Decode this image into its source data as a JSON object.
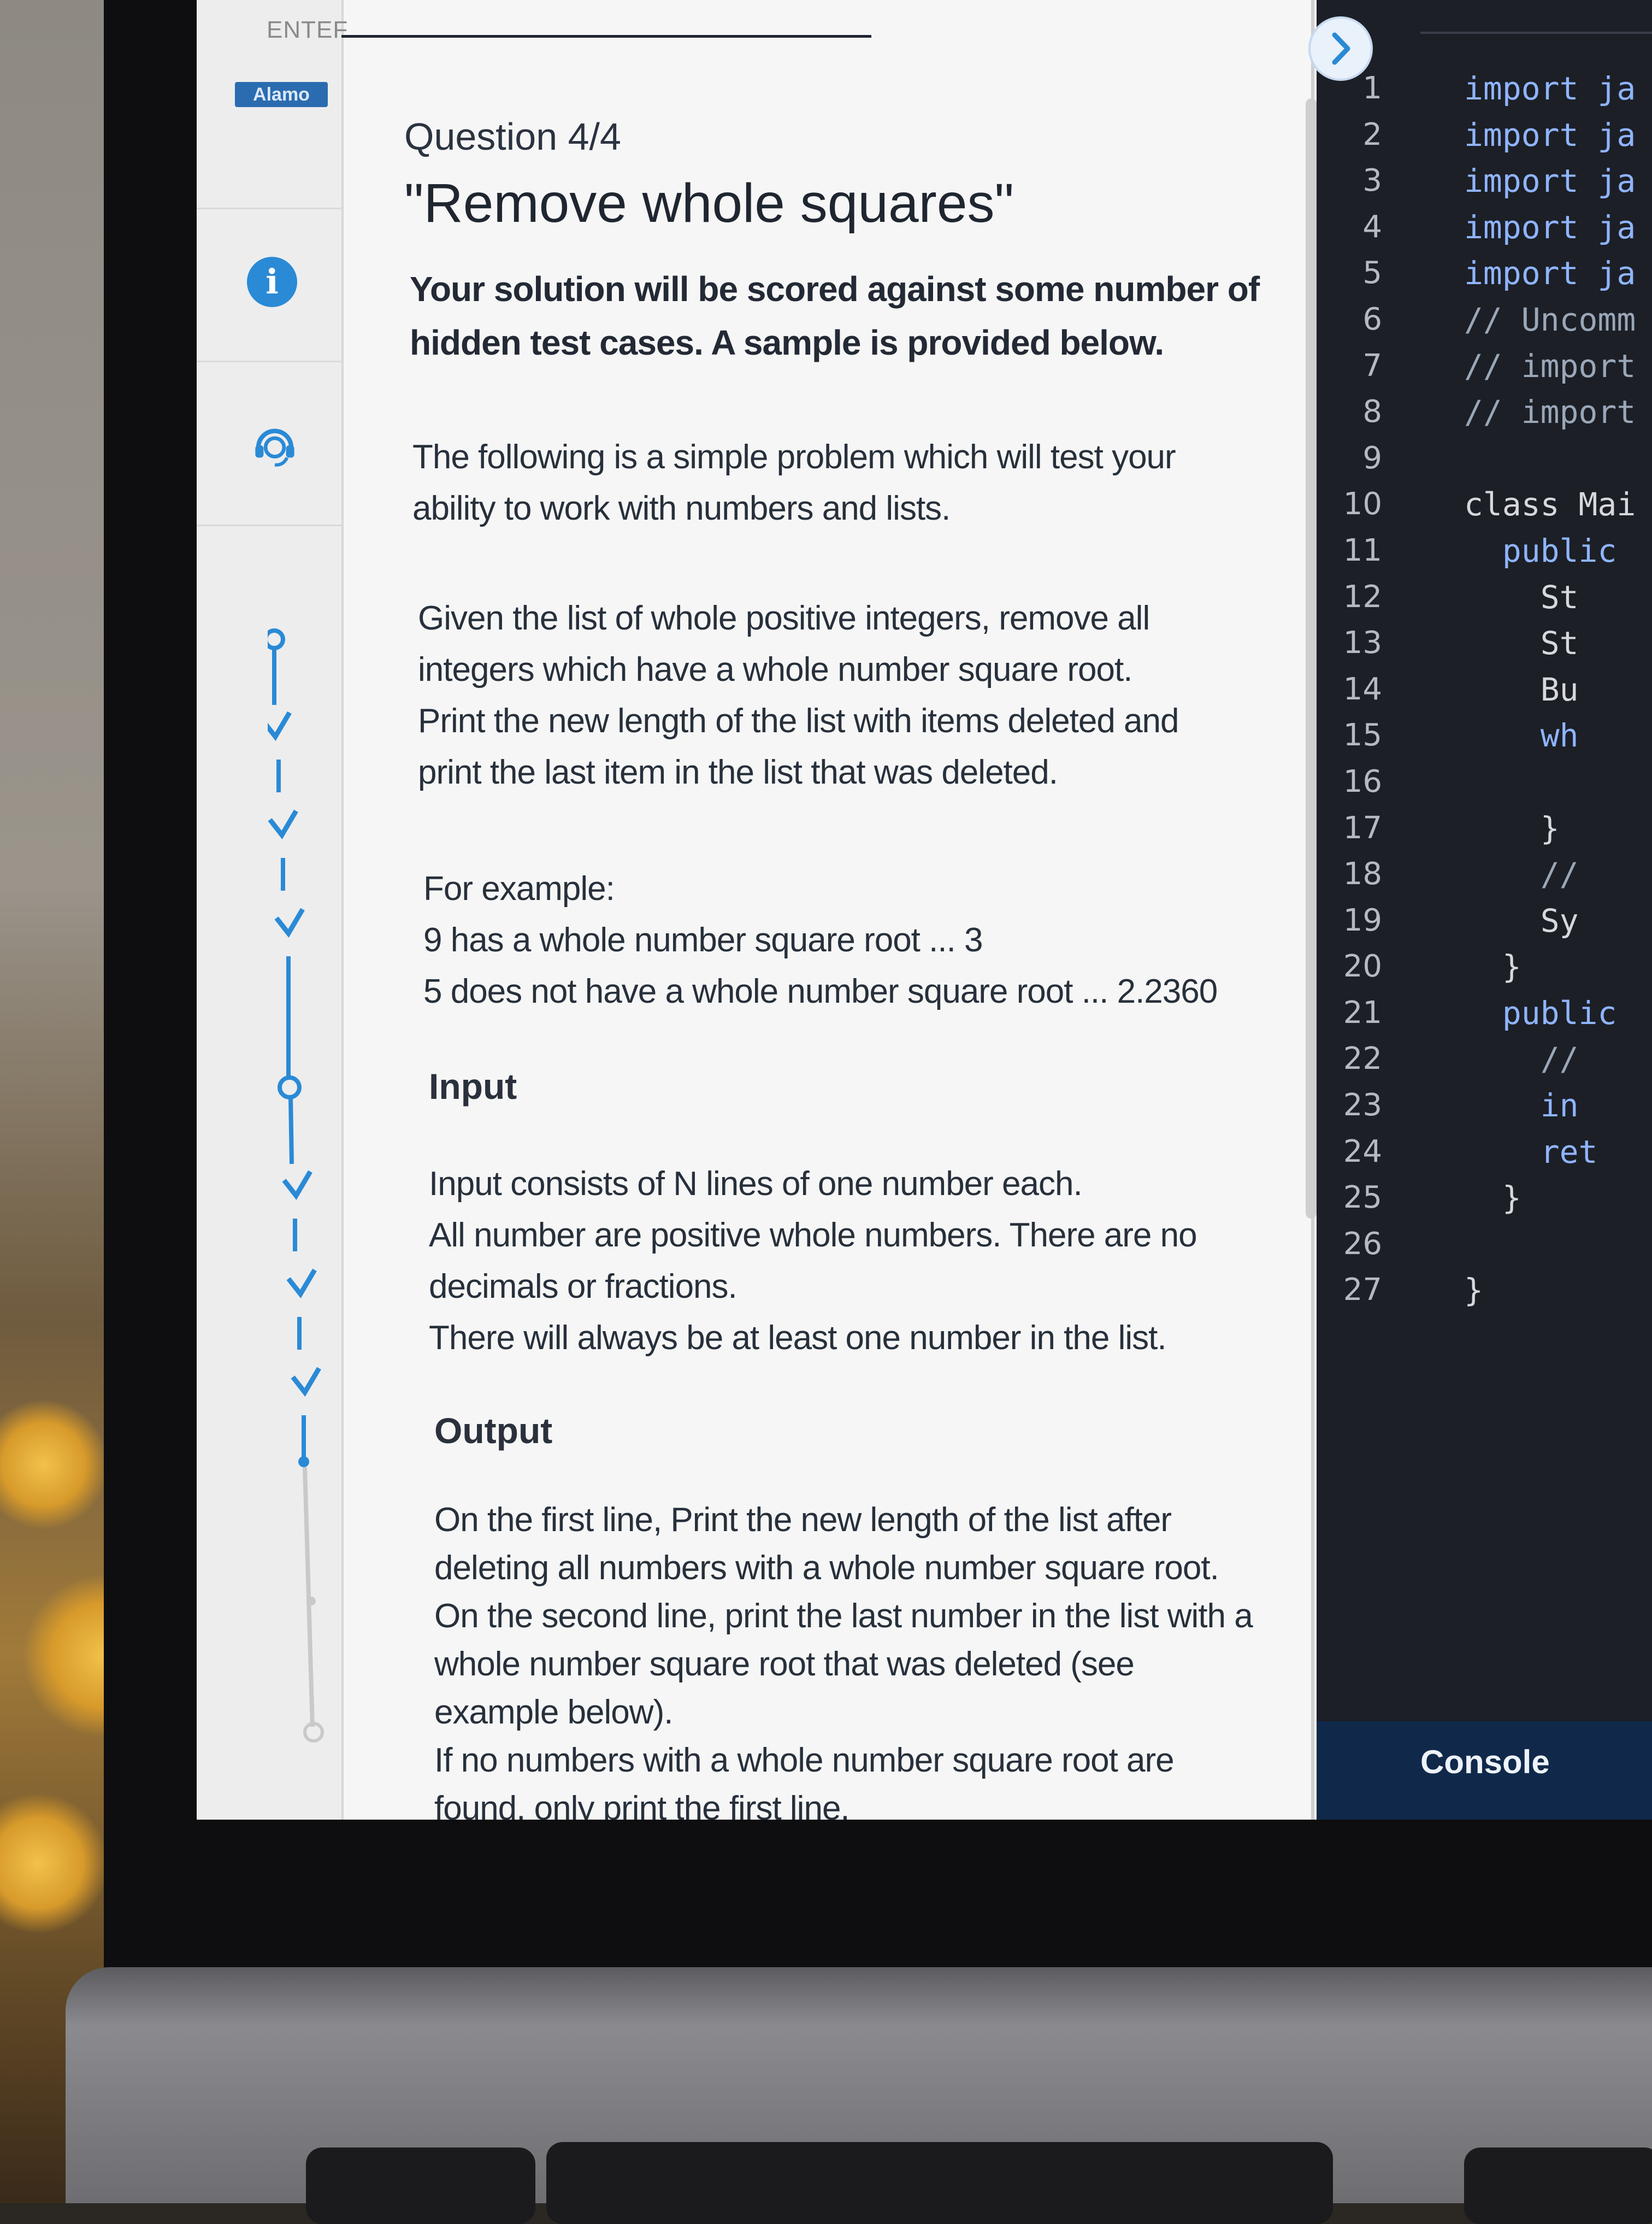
{
  "app": {
    "brand_partial": "ENTEF",
    "brand_badge": "Alamo"
  },
  "question": {
    "number_label": "Question 4/4",
    "title": "\"Remove whole squares\"",
    "lead_line1": "Your solution will be scored against some number of",
    "lead_line2": "hidden test cases. A sample is provided below.",
    "intro_line1": "The following is a simple problem which will test your",
    "intro_line2": "ability to work with numbers and lists.",
    "task_line1": "Given the list of whole positive integers, remove all",
    "task_line2": "integers which have a whole number square root.",
    "task_line3": "Print the new length of the list with items deleted and",
    "task_line4": "print the last item in the list that was deleted.",
    "example_head": "For example:",
    "example_1": "9 has a whole number square root ... 3",
    "example_2": "5 does not have a whole number square root ... 2.2360",
    "input_heading": "Input",
    "input_line1": "Input consists of N lines of one number each.",
    "input_line2": "All number are positive whole numbers. There are no",
    "input_line3": "decimals or fractions.",
    "input_line4": "There will always be at least one number in the list.",
    "output_heading": "Output",
    "output_line1": "On the first line, Print the new length of the list after",
    "output_line2": "deleting all numbers with a whole number square root.",
    "output_line3": "On the second line, print the last number in the list with a",
    "output_line4": "whole number square root that was deleted (see",
    "output_line5": "example below).",
    "output_line6": "If no numbers with a whole number square root are",
    "output_line7": "found, only print the first line."
  },
  "editor": {
    "line_numbers": [
      "1",
      "2",
      "3",
      "4",
      "5",
      "6",
      "7",
      "8",
      "9",
      "10",
      "11",
      "12",
      "13",
      "14",
      "15",
      "16",
      "17",
      "18",
      "19",
      "20",
      "21",
      "22",
      "23",
      "24",
      "25",
      "26",
      "27"
    ],
    "code_lines": [
      {
        "indent": "",
        "text": "import ja",
        "kind": "kw"
      },
      {
        "indent": "",
        "text": "import ja",
        "kind": "kw"
      },
      {
        "indent": "",
        "text": "import ja",
        "kind": "kw"
      },
      {
        "indent": "",
        "text": "import ja",
        "kind": "kw"
      },
      {
        "indent": "",
        "text": "import ja",
        "kind": "kw"
      },
      {
        "indent": "",
        "text": "// Uncomm",
        "kind": "cm"
      },
      {
        "indent": "",
        "text": "// import",
        "kind": "cm"
      },
      {
        "indent": "",
        "text": "// import",
        "kind": "cm"
      },
      {
        "indent": "",
        "text": "",
        "kind": "plain"
      },
      {
        "indent": "",
        "text": "class Mai",
        "kind": "plain"
      },
      {
        "indent": "  ",
        "text": "public",
        "kind": "kw"
      },
      {
        "indent": "    ",
        "text": "St",
        "kind": "plain"
      },
      {
        "indent": "    ",
        "text": "St",
        "kind": "plain"
      },
      {
        "indent": "    ",
        "text": "Bu",
        "kind": "plain"
      },
      {
        "indent": "    ",
        "text": "wh",
        "kind": "kw"
      },
      {
        "indent": "",
        "text": "",
        "kind": "plain"
      },
      {
        "indent": "    ",
        "text": "}",
        "kind": "plain"
      },
      {
        "indent": "    ",
        "text": "//",
        "kind": "cm"
      },
      {
        "indent": "    ",
        "text": "Sy",
        "kind": "plain"
      },
      {
        "indent": "  ",
        "text": "}",
        "kind": "plain"
      },
      {
        "indent": "  ",
        "text": "public",
        "kind": "kw"
      },
      {
        "indent": "    ",
        "text": "//",
        "kind": "cm"
      },
      {
        "indent": "    ",
        "text": "in",
        "kind": "kw"
      },
      {
        "indent": "    ",
        "text": "ret",
        "kind": "kw"
      },
      {
        "indent": "  ",
        "text": "}",
        "kind": "plain"
      },
      {
        "indent": "",
        "text": "",
        "kind": "plain"
      },
      {
        "indent": "}",
        "text": "",
        "kind": "plain"
      }
    ],
    "console_label": "Console"
  },
  "colors": {
    "accent": "#2a8ad6",
    "editor_bg": "#1c1f26",
    "console_bar": "#10294a"
  },
  "icons": [
    "info-icon",
    "support-agent-icon",
    "chevron-right-icon",
    "check-icon"
  ]
}
